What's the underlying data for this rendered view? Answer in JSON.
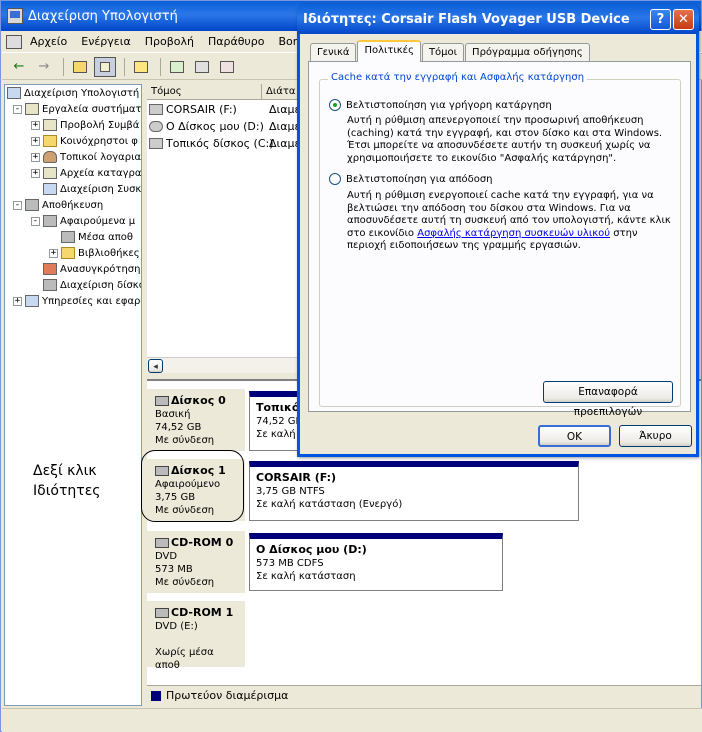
{
  "main_window": {
    "title": "Διαχείριση Υπολογιστή",
    "menu": [
      "Αρχείο",
      "Ενέργεια",
      "Προβολή",
      "Παράθυρο",
      "Βοηθεια"
    ]
  },
  "tree": {
    "items": [
      {
        "label": "Διαχείριση Υπολογιστή",
        "icon": "computer-icon"
      },
      {
        "label": "Εργαλεία συστήματ",
        "icon": "tools-icon"
      },
      {
        "label": "Προβολή Συμβά",
        "icon": "event-viewer-icon"
      },
      {
        "label": "Κοινόχρηστοι φ",
        "icon": "shared-folder-icon"
      },
      {
        "label": "Τοπικοί λογαρια",
        "icon": "users-icon"
      },
      {
        "label": "Αρχεία καταγρα",
        "icon": "log-icon"
      },
      {
        "label": "Διαχείριση Συσκ",
        "icon": "device-manager-icon"
      },
      {
        "label": "Αποθήκευση",
        "icon": "storage-icon"
      },
      {
        "label": "Αφαιρούμενα μ",
        "icon": "removable-icon"
      },
      {
        "label": "Μέσα αποθ",
        "icon": "media-icon"
      },
      {
        "label": "Βιβλιοθήκες",
        "icon": "library-folder-icon"
      },
      {
        "label": "Ανασυγκρότηση",
        "icon": "defrag-icon"
      },
      {
        "label": "Διαχείριση δίσκο",
        "icon": "disk-management-icon"
      },
      {
        "label": "Υπηρεσίες και εφαρ",
        "icon": "services-icon"
      }
    ]
  },
  "volume_list": {
    "col_volume": "Τόμος",
    "col_layout": "Διάτα",
    "rows": [
      {
        "name": "CORSAIR (F:)",
        "layout": "Διαμέ"
      },
      {
        "name": "Ο Δίσκος μου (D:)",
        "layout": "Διαμέ"
      },
      {
        "name": "Τοπικός δίσκος (C:)",
        "layout": "Διαμέ"
      }
    ]
  },
  "disks": [
    {
      "name": "Δίσκος 0",
      "type": "Βασική",
      "size": "74,52 GB",
      "status": "Με σύνδεση",
      "part_name": "Τοπικός",
      "part_size": "74,52 GB",
      "part_status": "Σε καλή"
    },
    {
      "name": "Δίσκος 1",
      "type": "Αφαιρούμενο",
      "size": "3,75 GB",
      "status": "Με σύνδεση",
      "part_name": "CORSAIR  (F:)",
      "part_size": "3,75 GB NTFS",
      "part_status": "Σε καλή κατάσταση (Ενεργό)"
    },
    {
      "name": "CD-ROM 0",
      "type": "DVD",
      "size": "573 MB",
      "status": "Με σύνδεση",
      "part_name": "Ο Δίσκος μου  (D:)",
      "part_size": "573 MB CDFS",
      "part_status": "Σε καλή κατάσταση"
    },
    {
      "name": "CD-ROM 1",
      "type": "DVD (E:)",
      "size": "",
      "status": "Χωρίς μέσα αποθ",
      "part_name": "",
      "part_size": "",
      "part_status": ""
    }
  ],
  "legend": {
    "label": "Πρωτεύον διαμέρισμα",
    "color": "#00007a"
  },
  "annotation": {
    "line1": "Δεξί κλικ",
    "line2": "Ιδιότητες"
  },
  "dialog": {
    "title": "Ιδιότητες: Corsair Flash Voyager USB Device",
    "help": "?",
    "close": "✕",
    "tabs": [
      "Γενικά",
      "Πολιτικές",
      "Τόμοι",
      "Πρόγραμμα οδήγησης"
    ],
    "active_tab": "Πολιτικές",
    "group_label": "Cache κατά την εγγραφή και Ασφαλής κατάργηση",
    "option1": {
      "label": "Βελτιστοποίηση για γρήγορη κατάργηση",
      "selected": true,
      "desc": "Αυτή η ρύθμιση απενεργοποιεί την προσωρινή αποθήκευση (caching) κατά την εγγραφή, και στον δίσκο και στα Windows. Έτσι μπορείτε να αποσυνδέσετε αυτήν τη συσκευή χωρίς να χρησιμοποιήσετε το εικονίδιο \"Ασφαλής κατάργηση\"."
    },
    "option2": {
      "label": "Βελτιστοποίηση για απόδοση",
      "selected": false,
      "desc_before": "Αυτή η ρύθμιση ενεργοποιεί cache κατά την εγγραφή, για να βελτιώσει την απόδοση του δίσκου στα Windows. Για να αποσυνδέσετε αυτή τη συσκευή από τον υπολογιστή, κάντε κλικ στο εικονίδιο ",
      "link": "Ασφαλής κατάργηση συσκευών υλικού",
      "desc_after": " στην περιοχή ειδοποιήσεων της γραμμής εργασιών."
    },
    "restore_button": "Επαναφορά προεπιλογών",
    "ok_button": "OK",
    "cancel_button": "Άκυρο"
  }
}
